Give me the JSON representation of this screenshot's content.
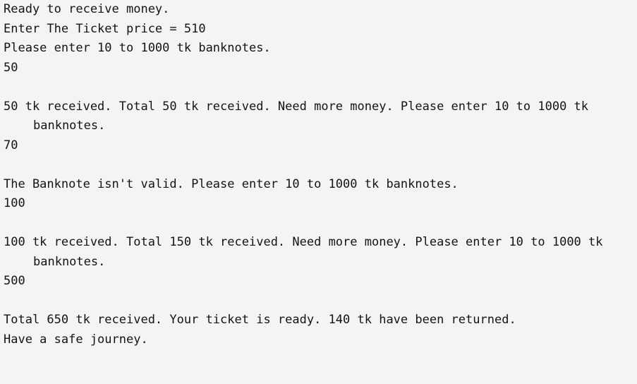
{
  "console": {
    "lines": [
      "Ready to receive money.",
      "Enter The Ticket price = 510",
      "Please enter 10 to 1000 tk banknotes.",
      "50",
      "",
      "50 tk received. Total 50 tk received. Need more money. Please enter 10 to 1000 tk",
      "banknotes.",
      "70",
      "",
      "The Banknote isn't valid. Please enter 10 to 1000 tk banknotes.",
      "100",
      "",
      "100 tk received. Total 150 tk received. Need more money. Please enter 10 to 1000 tk",
      "banknotes.",
      "500",
      "",
      "Total 650 tk received. Your ticket is ready. 140 tk have been returned.",
      "Have a safe journey."
    ]
  }
}
